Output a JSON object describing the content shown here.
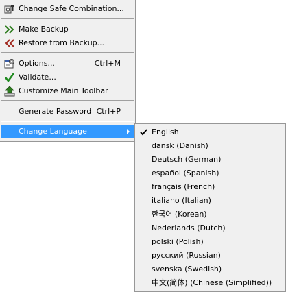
{
  "main_menu": {
    "items": [
      {
        "label": "Change Safe Combination...",
        "shortcut": "",
        "icon": "safe-combination-icon"
      },
      {
        "label": "Make Backup",
        "shortcut": "",
        "icon": "double-chevron-right-icon",
        "icon_color": "#2e7d1f"
      },
      {
        "label": "Restore from Backup...",
        "shortcut": "",
        "icon": "double-chevron-left-icon",
        "icon_color": "#a0281e"
      },
      {
        "label": "Options...",
        "shortcut": "Ctrl+M",
        "icon": "options-icon"
      },
      {
        "label": "Validate...",
        "shortcut": "",
        "icon": "checkmark-icon",
        "icon_color": "#1f8a1f"
      },
      {
        "label": "Customize Main Toolbar",
        "shortcut": "",
        "icon": "toolbar-icon"
      },
      {
        "label": "Generate Password",
        "shortcut": "Ctrl+P",
        "icon": ""
      },
      {
        "label": "Change Language",
        "shortcut": "",
        "icon": "",
        "submenu": true
      }
    ],
    "highlight_color": "#3399ff"
  },
  "language_menu": {
    "selected": "English",
    "items": [
      "English",
      "dansk (Danish)",
      "Deutsch (German)",
      "español (Spanish)",
      "français (French)",
      "italiano (Italian)",
      "한국어 (Korean)",
      "Nederlands (Dutch)",
      "polski (Polish)",
      "русский (Russian)",
      "svenska (Swedish)",
      "中文(简体) (Chinese (Simplified))"
    ]
  }
}
